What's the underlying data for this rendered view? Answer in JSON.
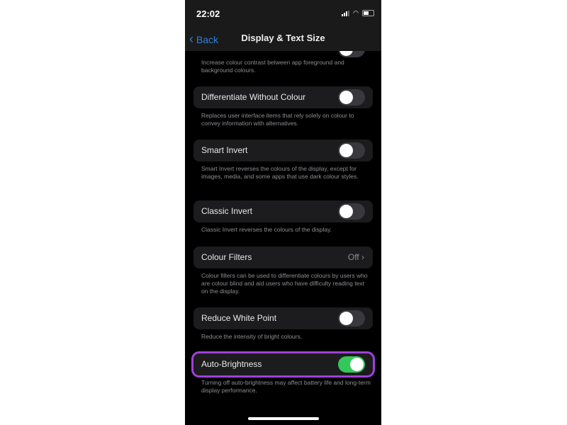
{
  "status": {
    "time": "22:02"
  },
  "nav": {
    "back": "Back",
    "title": "Display & Text Size"
  },
  "top_desc": "Increase colour contrast between app foreground and background colours.",
  "rows": [
    {
      "label": "Differentiate Without Colour",
      "on": false,
      "desc": "Replaces user interface items that rely solely on colour to convey information with alternatives."
    },
    {
      "label": "Smart Invert",
      "on": false,
      "desc": "Smart Invert reverses the colours of the display, except for images, media, and some apps that use dark colour styles."
    },
    {
      "label": "Classic Invert",
      "on": false,
      "desc": "Classic Invert reverses the colours of the display."
    },
    {
      "label": "Colour Filters",
      "value": "Off",
      "desc": "Colour filters can be used to differentiate colours by users who are colour blind and aid users who have difficulty reading text on the display."
    },
    {
      "label": "Reduce White Point",
      "on": false,
      "desc": "Reduce the intensity of bright colours."
    },
    {
      "label": "Auto-Brightness",
      "on": true,
      "desc": "Turning off auto-brightness may affect battery life and long-term display performance."
    }
  ],
  "colors": {
    "accent": "#2f7fd8",
    "toggle_on": "#34c759",
    "highlight": "#a040d8"
  }
}
